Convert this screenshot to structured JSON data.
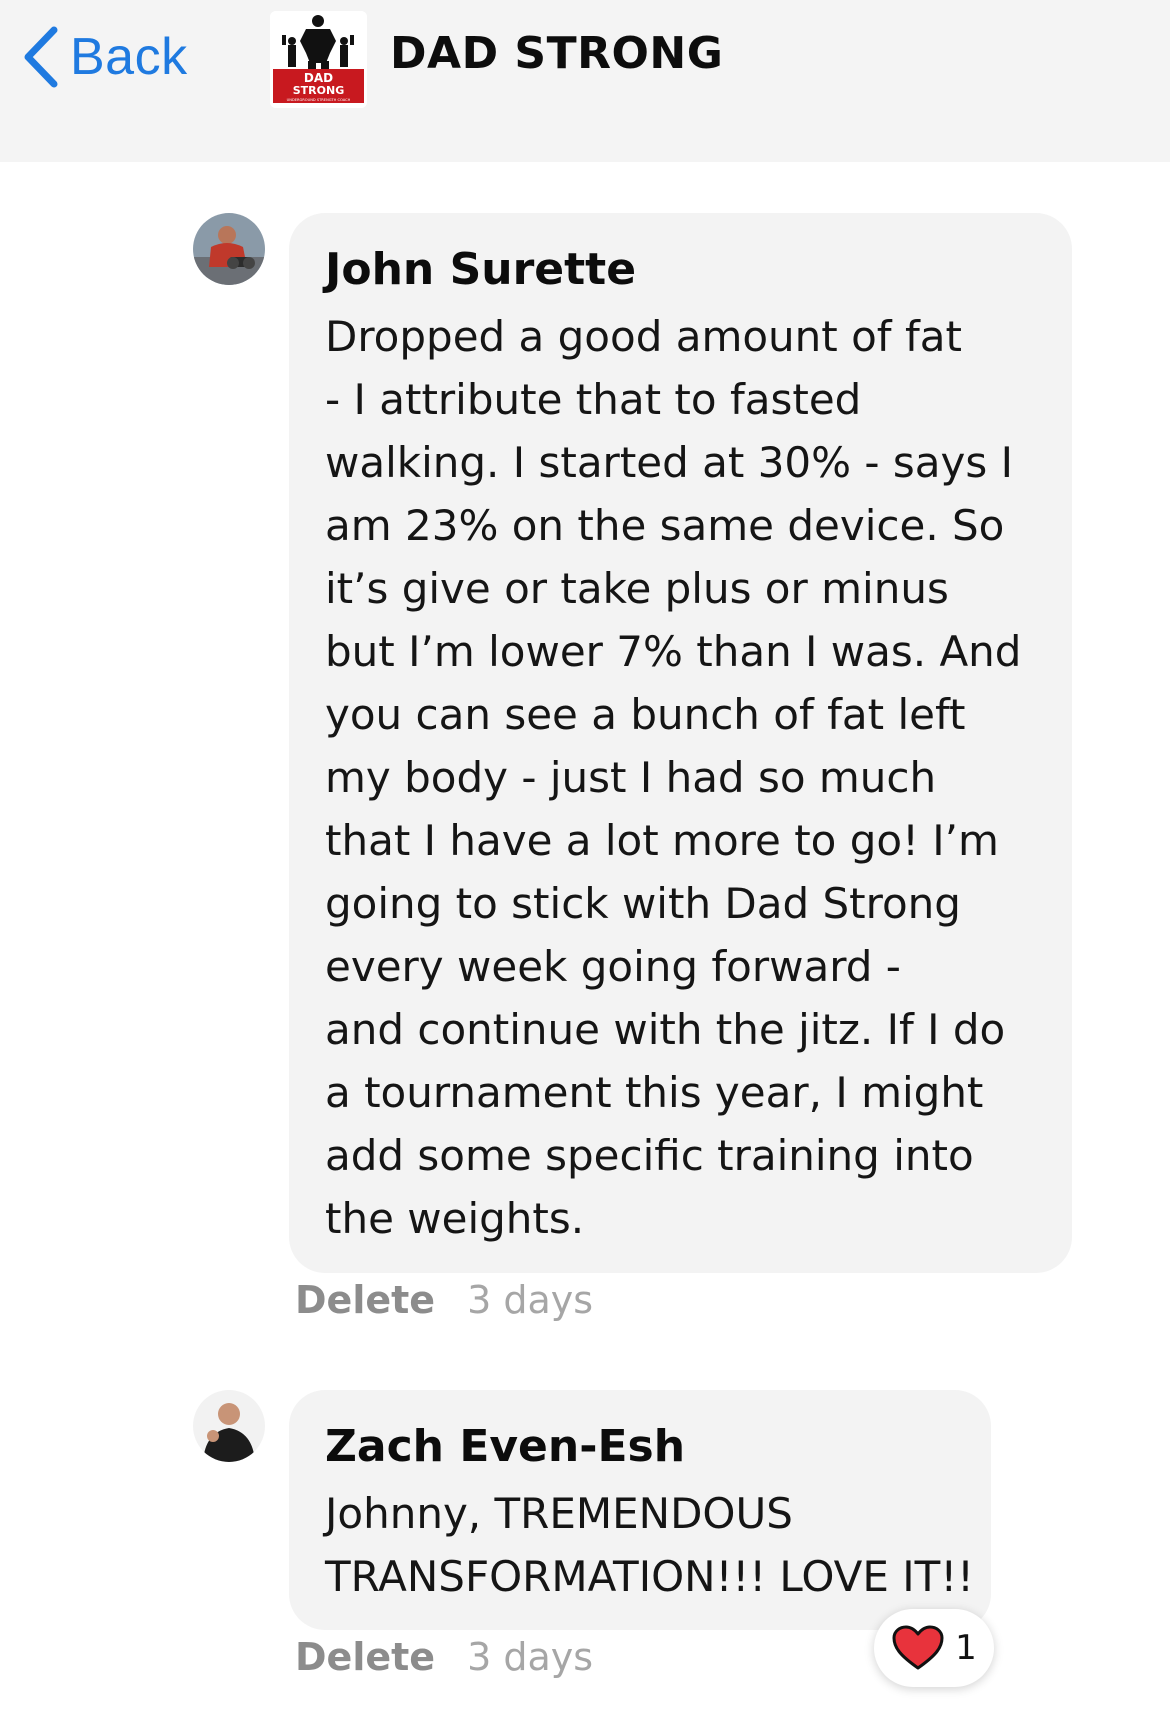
{
  "header": {
    "back_label": "Back",
    "group_title": "DAD STRONG",
    "logo": {
      "line1": "DAD",
      "line2": "STRONG",
      "tagline": "UNDERGROUND STRENGTH COACH",
      "icon": "dad-strong-logo-icon"
    },
    "accent_color": "#1f7ae0"
  },
  "comments": [
    {
      "author": "John Surette",
      "avatar_icon": "user-avatar-icon",
      "lines": [
        "Dropped a good amount of fat",
        "- I attribute that to fasted",
        "walking. I started at 30% - says I",
        "am 23% on the same device. So",
        "it’s give or take plus or minus",
        "but I’m lower 7% than I was. And",
        "you can see a bunch of fat left",
        "my body - just I had so much",
        "that I have a lot more to go! I’m",
        "going to stick with Dad Strong",
        "every week going forward -",
        "and continue with the jitz. If I do",
        "a tournament this year, I might",
        "add some specific training into",
        "the weights."
      ],
      "delete_label": "Delete",
      "timestamp": "3 days"
    },
    {
      "author": "Zach Even-Esh",
      "avatar_icon": "user-avatar-icon",
      "lines": [
        "Johnny, TREMENDOUS",
        "TRANSFORMATION!!! LOVE IT!!"
      ],
      "delete_label": "Delete",
      "timestamp": "3 days",
      "reaction": {
        "icon": "heart-icon",
        "count": "1",
        "color": "#e8333c"
      }
    }
  ]
}
